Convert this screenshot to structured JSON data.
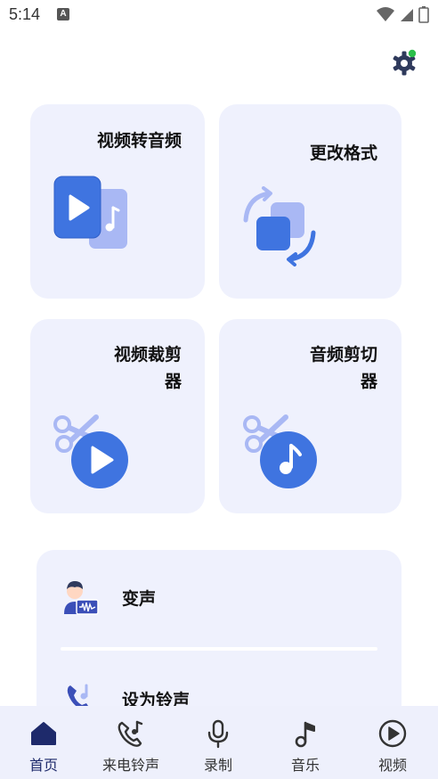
{
  "status_bar": {
    "time": "5:14",
    "notification_letter": "A"
  },
  "cards": {
    "video_to_audio": {
      "title": "视频转音频"
    },
    "change_format": {
      "title": "更改格式"
    },
    "video_trim": {
      "title_line1": "视频裁剪",
      "title_line2": "器"
    },
    "audio_cut": {
      "title_line1": "音频剪切",
      "title_line2": "器"
    }
  },
  "features": [
    {
      "label": "变声",
      "icon": "voice-changer-icon"
    },
    {
      "label": "设为铃声",
      "icon": "phone-ringtone-icon"
    }
  ],
  "tabs": [
    {
      "label": "首页",
      "icon": "home-icon",
      "active": true
    },
    {
      "label": "来电铃声",
      "icon": "phone-music-icon",
      "active": false
    },
    {
      "label": "录制",
      "icon": "microphone-icon",
      "active": false
    },
    {
      "label": "音乐",
      "icon": "music-note-icon",
      "active": false
    },
    {
      "label": "视频",
      "icon": "play-circle-icon",
      "active": false
    }
  ],
  "colors": {
    "accent": "#3f74e0",
    "accent_light": "#a9b8f4",
    "card_bg": "#eff1fd",
    "tab_active": "#1e2a6b",
    "notification_dot": "#2bbf4a"
  }
}
